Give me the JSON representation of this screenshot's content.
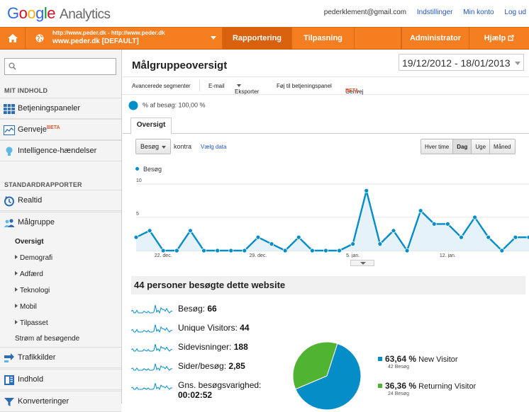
{
  "header": {
    "logo_google": "Google",
    "logo_product": "Analytics",
    "email": "pederklement@gmail.com",
    "settings": "Indstillinger",
    "account": "Min konto",
    "logout": "Log ud"
  },
  "topbar": {
    "account_line1": "http://www.peder.dk - http://www.peder.dk",
    "account_line2": "www.peder.dk [DEFAULT]",
    "tabs": [
      "Rapportering",
      "Tilpasning",
      "Administrator",
      "Hjælp"
    ],
    "accent": "#f57e20"
  },
  "sidebar": {
    "search_placeholder": "",
    "section_my": "MIT INDHOLD",
    "my_items": [
      "Betjeningspaneler",
      "Genveje",
      "Intelligence-hændelser"
    ],
    "beta": "BETA",
    "section_std": "STANDARDRAPPORTER",
    "realtime": "Realtid",
    "audience": "Målgruppe",
    "audience_sub": [
      "Oversigt",
      "Demografi",
      "Adfærd",
      "Teknologi",
      "Mobil",
      "Tilpasset",
      "Strøm af besøgende"
    ],
    "traffic": "Trafikkilder",
    "content": "Indhold",
    "conversions": "Konverteringer"
  },
  "report": {
    "title": "Målgruppeoversigt",
    "date_range": "19/12/2012 - 18/01/2013",
    "toolbar": [
      "Avancerede segmenter",
      "E-mail",
      "Eksporter",
      "Føj til betjeningspanel",
      "Genvej"
    ],
    "segment": "% af besøg: 100,00 %",
    "tab": "Oversigt",
    "metric_select": "Besøg",
    "vs": "kontra",
    "choose": "Vælg data",
    "periods": [
      "Hver time",
      "Dag",
      "Uge",
      "Måned"
    ],
    "legend": "Besøg",
    "summary_title": "44 personer besøgte dette website",
    "metrics": [
      {
        "label": "Besøg:",
        "value": "66"
      },
      {
        "label": "Unique Visitors:",
        "value": "44"
      },
      {
        "label": "Sidevisninger:",
        "value": "188"
      },
      {
        "label": "Sider/besøg:",
        "value": "2,85"
      },
      {
        "label": "Gns. besøgsvarighed:",
        "value": "00:02:52"
      }
    ],
    "pie": [
      {
        "pct": "63,64 %",
        "name": "New Visitor",
        "count": "42 Besøg",
        "color": "#058dc7"
      },
      {
        "pct": "36,36 %",
        "name": "Returning Visitor",
        "count": "24 Besøg",
        "color": "#50b432"
      }
    ]
  },
  "chart_data": {
    "type": "area",
    "title": "",
    "series": [
      {
        "name": "Besøg",
        "values": [
          2,
          3,
          0,
          0,
          3,
          0,
          0,
          0,
          0,
          2,
          1,
          0,
          2,
          0,
          0,
          0,
          1,
          9,
          1,
          3,
          0,
          6,
          4,
          4,
          2,
          5,
          2,
          0,
          2,
          2
        ]
      }
    ],
    "ylim": [
      0,
      10
    ],
    "yticks": [
      5,
      10
    ],
    "xtick_labels": [
      "22. dec.",
      "29. dec.",
      "5. jan.",
      "12. jan."
    ],
    "xtick_index": [
      2,
      9,
      16,
      23
    ],
    "color": "#058dc7"
  }
}
